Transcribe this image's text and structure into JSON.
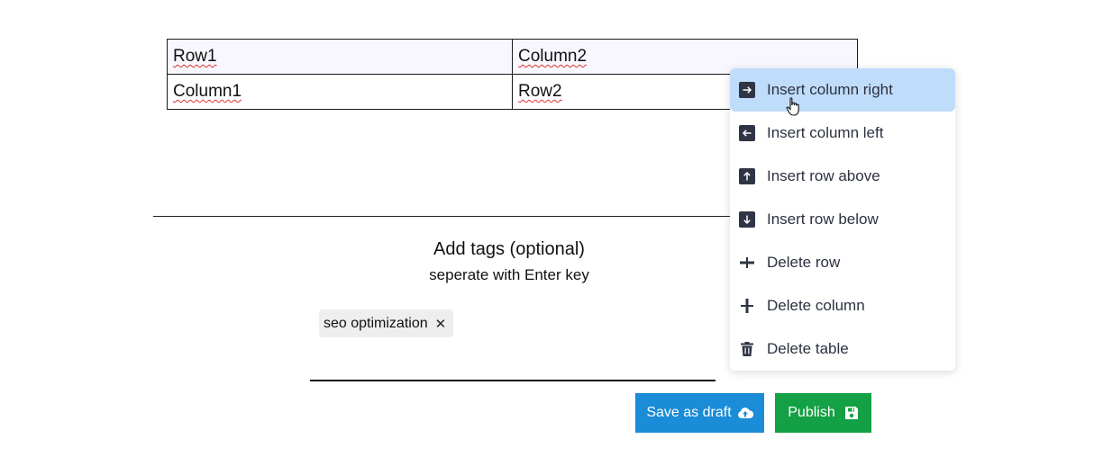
{
  "table": {
    "rows": [
      [
        "Row1",
        "Column2"
      ],
      [
        "Column1",
        "Row2"
      ]
    ]
  },
  "tags": {
    "title": "Add tags (optional)",
    "subtitle": "seperate with Enter key",
    "items": [
      {
        "label": "seo optimization",
        "remove": "✕"
      }
    ]
  },
  "actions": {
    "save_draft": "Save as draft",
    "publish": "Publish"
  },
  "context_menu": {
    "items": [
      {
        "label": "Insert column right",
        "icon": "arrow-right-icon",
        "active": true
      },
      {
        "label": "Insert column left",
        "icon": "arrow-left-icon",
        "active": false
      },
      {
        "label": "Insert row above",
        "icon": "arrow-up-icon",
        "active": false
      },
      {
        "label": "Insert row below",
        "icon": "arrow-down-icon",
        "active": false
      },
      {
        "label": "Delete row",
        "icon": "delete-row-icon",
        "active": false
      },
      {
        "label": "Delete column",
        "icon": "delete-column-icon",
        "active": false
      },
      {
        "label": "Delete table",
        "icon": "trash-icon",
        "active": false
      }
    ]
  },
  "colors": {
    "draft_button": "#1a8cd8",
    "publish_button": "#14a044",
    "menu_highlight": "#c0dcfb",
    "icon_fill": "#2f3545"
  }
}
